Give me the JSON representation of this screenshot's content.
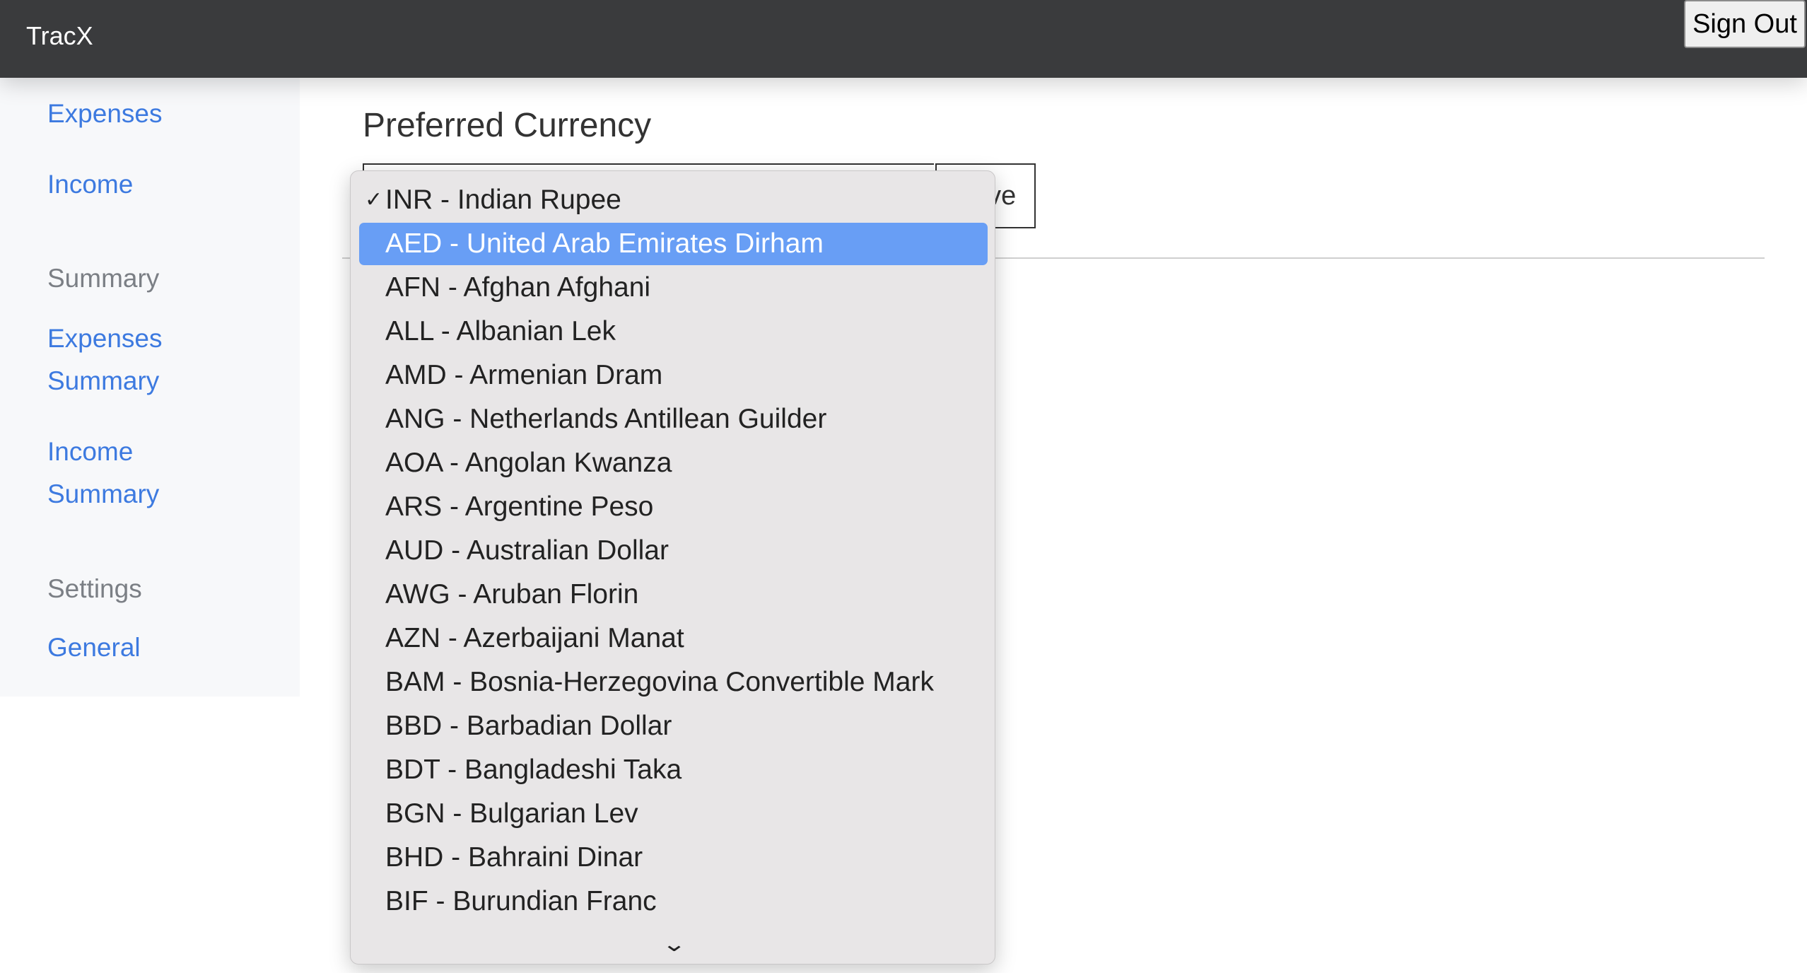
{
  "header": {
    "brand": "TracX",
    "sign_out": "Sign Out"
  },
  "sidebar": {
    "items": [
      {
        "label": "Expenses",
        "type": "link"
      },
      {
        "label": "Income",
        "type": "link"
      },
      {
        "label": "Summary",
        "type": "heading"
      },
      {
        "label": "Expenses",
        "type": "link"
      },
      {
        "label": "Summary",
        "type": "link"
      },
      {
        "label": "Income",
        "type": "link"
      },
      {
        "label": "Summary",
        "type": "link"
      },
      {
        "label": "Settings",
        "type": "heading"
      },
      {
        "label": "General",
        "type": "link"
      }
    ]
  },
  "main": {
    "title": "Preferred Currency",
    "save_label": "Save",
    "selected": "INR - Indian Rupee",
    "highlighted": "AED - United Arab Emirates Dirham",
    "options": [
      "INR - Indian Rupee",
      "AED - United Arab Emirates Dirham",
      "AFN - Afghan Afghani",
      "ALL - Albanian Lek",
      "AMD - Armenian Dram",
      "ANG - Netherlands Antillean Guilder",
      "AOA - Angolan Kwanza",
      "ARS - Argentine Peso",
      "AUD - Australian Dollar",
      "AWG - Aruban Florin",
      "AZN - Azerbaijani Manat",
      "BAM - Bosnia-Herzegovina Convertible Mark",
      "BBD - Barbadian Dollar",
      "BDT - Bangladeshi Taka",
      "BGN - Bulgarian Lev",
      "BHD - Bahraini Dinar",
      "BIF - Burundian Franc"
    ]
  },
  "colors": {
    "header": "#3a3b3d",
    "link": "#3d7ae0",
    "highlight": "#689ef5",
    "dropdown": "#e8e6e7"
  },
  "icons": {
    "checkmark": "✓",
    "scroll_down": "⌄"
  }
}
